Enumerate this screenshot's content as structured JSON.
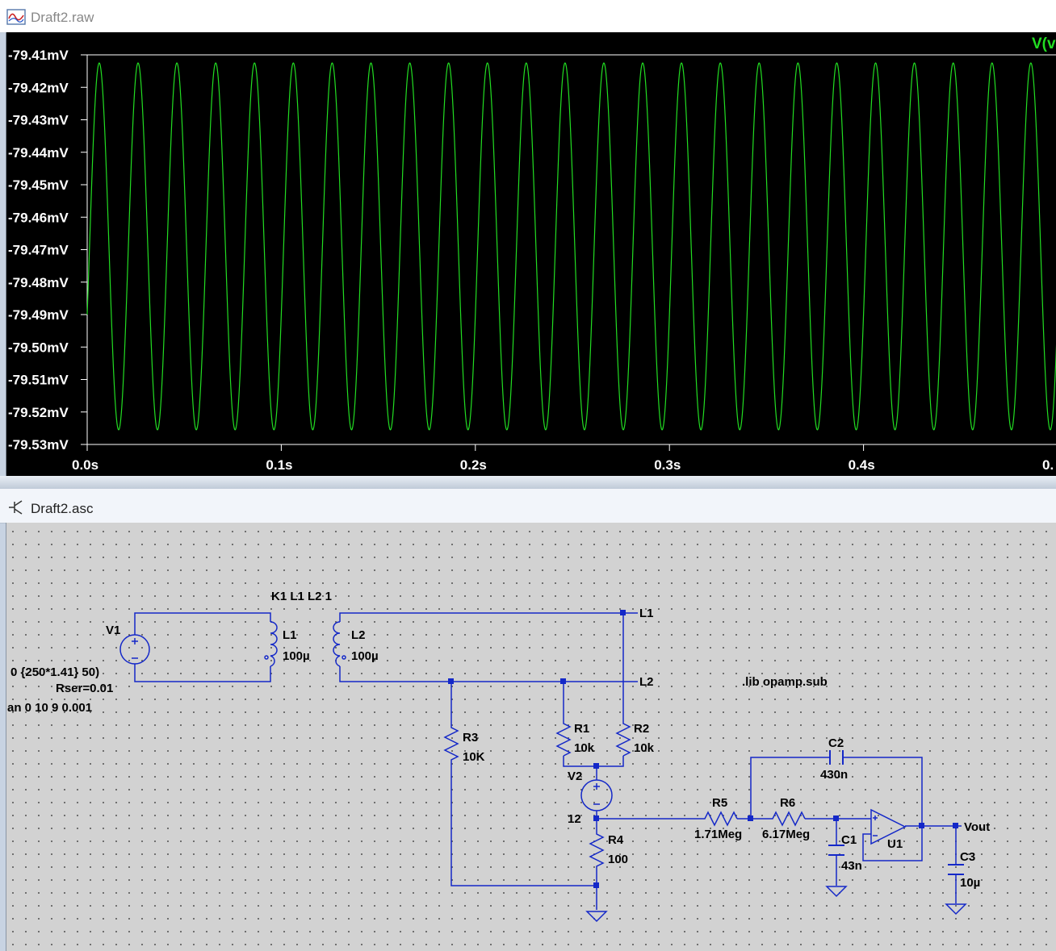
{
  "waveform_window": {
    "title": "Draft2.raw",
    "trace_label": "V(v",
    "trace_color": "#22dd22",
    "background": "#000000",
    "chart_data": {
      "type": "line",
      "title": "",
      "series": [
        {
          "name": "V(v",
          "color": "#22dd22"
        }
      ],
      "y_tick_labels": [
        "-79.41mV",
        "-79.42mV",
        "-79.43mV",
        "-79.44mV",
        "-79.45mV",
        "-79.46mV",
        "-79.47mV",
        "-79.48mV",
        "-79.49mV",
        "-79.50mV",
        "-79.51mV",
        "-79.52mV",
        "-79.53mV"
      ],
      "y_ticks": [
        -79.41,
        -79.42,
        -79.43,
        -79.44,
        -79.45,
        -79.46,
        -79.47,
        -79.48,
        -79.49,
        -79.5,
        -79.51,
        -79.52,
        -79.53
      ],
      "ylim": [
        -79.53,
        -79.41
      ],
      "x_tick_labels": [
        "0.0s",
        "0.1s",
        "0.2s",
        "0.3s",
        "0.4s",
        "0."
      ],
      "x_ticks": [
        0.0,
        0.1,
        0.2,
        0.3,
        0.4,
        0.5
      ],
      "xlim": [
        0.0,
        0.5
      ],
      "signal": {
        "frequency_hz": 50,
        "peak_mv": -79.4125,
        "trough_mv": -79.5255,
        "start_mv": -79.49
      },
      "grid": false
    }
  },
  "schematic_window": {
    "title": "Draft2.asc",
    "wire_color": "#1428c8",
    "text_color": "#000000",
    "directive_coupling": "K1 L1 L2 1",
    "directive_lib": ".lib opamp.sub",
    "v1_name": "V1",
    "v1_value": "0 {250*1.41} 50)",
    "v1_rser": "Rser=0.01",
    "tran_directive": "an 0 10 9 0.001",
    "l1_name": "L1",
    "l1_value": "100µ",
    "l2_name": "L2",
    "l2_value": "100µ",
    "net_l1": "L1",
    "net_l2": "L2",
    "r1_name": "R1",
    "r1_value": "10k",
    "r2_name": "R2",
    "r2_value": "10k",
    "r3_name": "R3",
    "r3_value": "10K",
    "r4_name": "R4",
    "r4_value": "100",
    "r5_name": "R5",
    "r5_value": "1.71Meg",
    "r6_name": "R6",
    "r6_value": "6.17Meg",
    "c1_name": "C1",
    "c1_value": "43n",
    "c2_name": "C2",
    "c2_value": "430n",
    "c3_name": "C3",
    "c3_value": "10µ",
    "v2_name": "V2",
    "v2_value": "12",
    "u1_name": "U1",
    "net_vout": "Vout"
  }
}
